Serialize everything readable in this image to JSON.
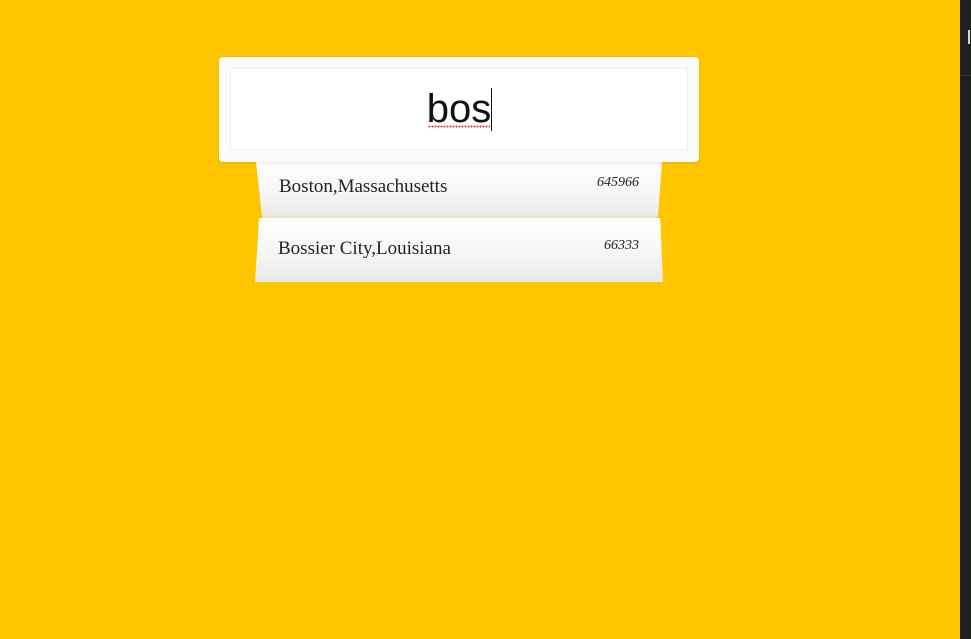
{
  "search": {
    "value": "bos"
  },
  "suggestions": [
    {
      "city": "Boston,Massachusetts",
      "population": "645966"
    },
    {
      "city": "Bossier City,Louisiana",
      "population": "66333"
    }
  ],
  "colors": {
    "background": "#ffc600",
    "card": "#fbfbfb",
    "input": "#ffffff",
    "text": "#222222",
    "side_panel": "#1e1e1e"
  }
}
